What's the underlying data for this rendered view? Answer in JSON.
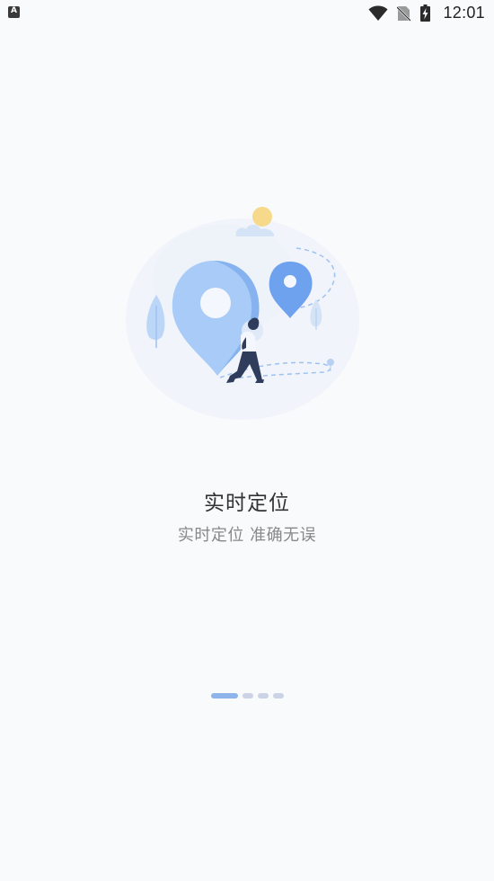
{
  "status_bar": {
    "app_badge": "A",
    "time": "12:01",
    "icons": [
      "wifi-icon",
      "no-sim-icon",
      "battery-charging-icon"
    ]
  },
  "onboarding": {
    "title": "实时定位",
    "subtitle": "实时定位 准确无误",
    "illustration": "location-pin-illustration",
    "pager": {
      "total_pages": 4,
      "active_index": 0
    }
  },
  "colors": {
    "background": "#f9fafc",
    "accent": "#6ea2ee",
    "pin_light": "#a9cbf7",
    "dot_active": "#8fb4ec",
    "dot_inactive": "#cdd3e6",
    "title_text": "#333333",
    "subtitle_text": "#888888"
  }
}
